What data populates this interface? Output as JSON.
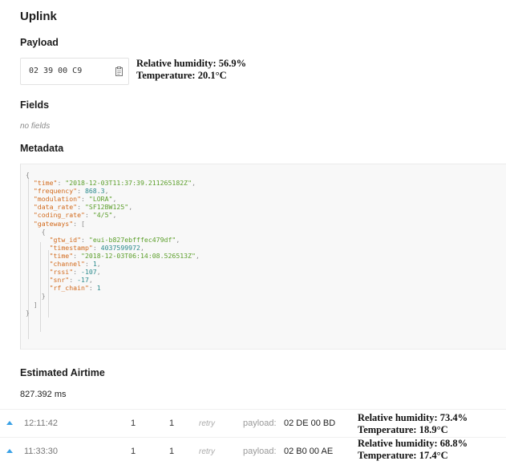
{
  "uplink": {
    "title": "Uplink",
    "payload_heading": "Payload",
    "payload_hex": "02 39 00 C9",
    "decoded": [
      "Relative humidity: 56.9%",
      "Temperature: 20.1°C"
    ],
    "fields_heading": "Fields",
    "fields_empty": "no fields",
    "metadata_heading": "Metadata",
    "metadata": {
      "time": "2018-12-03T11:37:39.211265182Z",
      "frequency": "868.3",
      "modulation": "LORA",
      "data_rate": "SF12BW125",
      "coding_rate": "4/5",
      "gateway": {
        "gtw_id": "eui-b827ebfffec479df",
        "timestamp": "4037599972",
        "time": "2018-12-03T06:14:08.526513Z",
        "channel": "1",
        "rssi": "-107",
        "snr": "-17",
        "rf_chain": "1"
      }
    },
    "airtime_heading": "Estimated Airtime",
    "airtime_value": "827.392 ms"
  },
  "rows": [
    {
      "time": "12:11:42",
      "col_a": "1",
      "col_b": "1",
      "retry": "retry",
      "payload_label": "payload:",
      "payload": "02 DE 00 BD",
      "decoded": [
        "Relative humidity: 73.4%",
        "Temperature: 18.9°C"
      ]
    },
    {
      "time": "11:33:30",
      "col_a": "1",
      "col_b": "1",
      "retry": "retry",
      "payload_label": "payload:",
      "payload": "02 B0 00 AE",
      "decoded": [
        "Relative humidity: 68.8%",
        "Temperature: 17.4°C"
      ]
    }
  ],
  "colors": {
    "accent": "#3aa1e6",
    "json_key": "#d26a1c",
    "json_string": "#5c9f2b",
    "json_number": "#2a8a8c"
  },
  "icons": {
    "copy": "clipboard-icon",
    "expand": "caret-up-icon"
  }
}
